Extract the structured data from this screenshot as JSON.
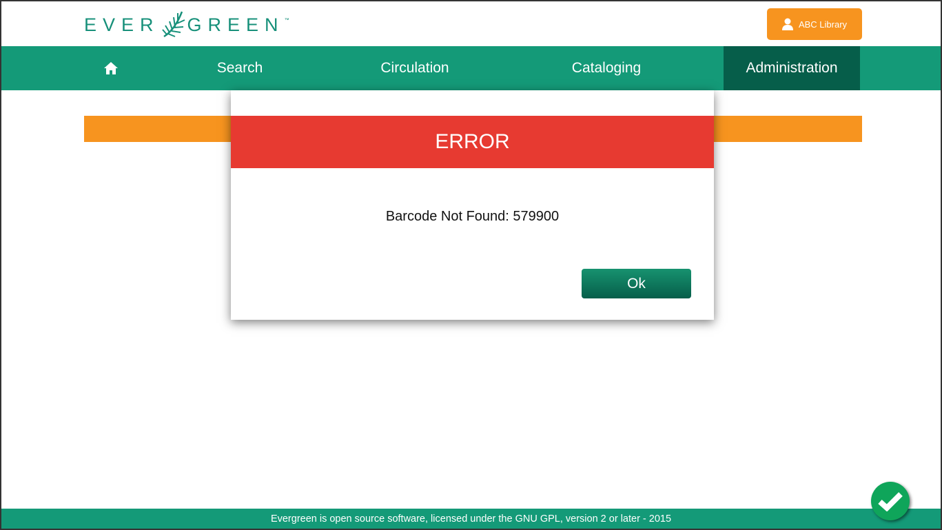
{
  "header": {
    "logo_text_left": "EVER",
    "logo_text_right": "GREEN",
    "logo_tm": "™",
    "user_label": "ABC Library"
  },
  "nav": {
    "items": [
      {
        "label": "Search"
      },
      {
        "label": "Circulation"
      },
      {
        "label": "Cataloging"
      },
      {
        "label": "Administration"
      }
    ]
  },
  "dialog": {
    "title": "ERROR",
    "message": "Barcode Not Found: 579900",
    "ok_label": "Ok"
  },
  "footer": {
    "text": "Evergreen is open source software, licensed under the GNU GPL, version 2 or later - 2015"
  },
  "colors": {
    "green": "#149a78",
    "dark_green": "#065e4a",
    "orange": "#f7941f",
    "error_red": "#e73a31"
  }
}
